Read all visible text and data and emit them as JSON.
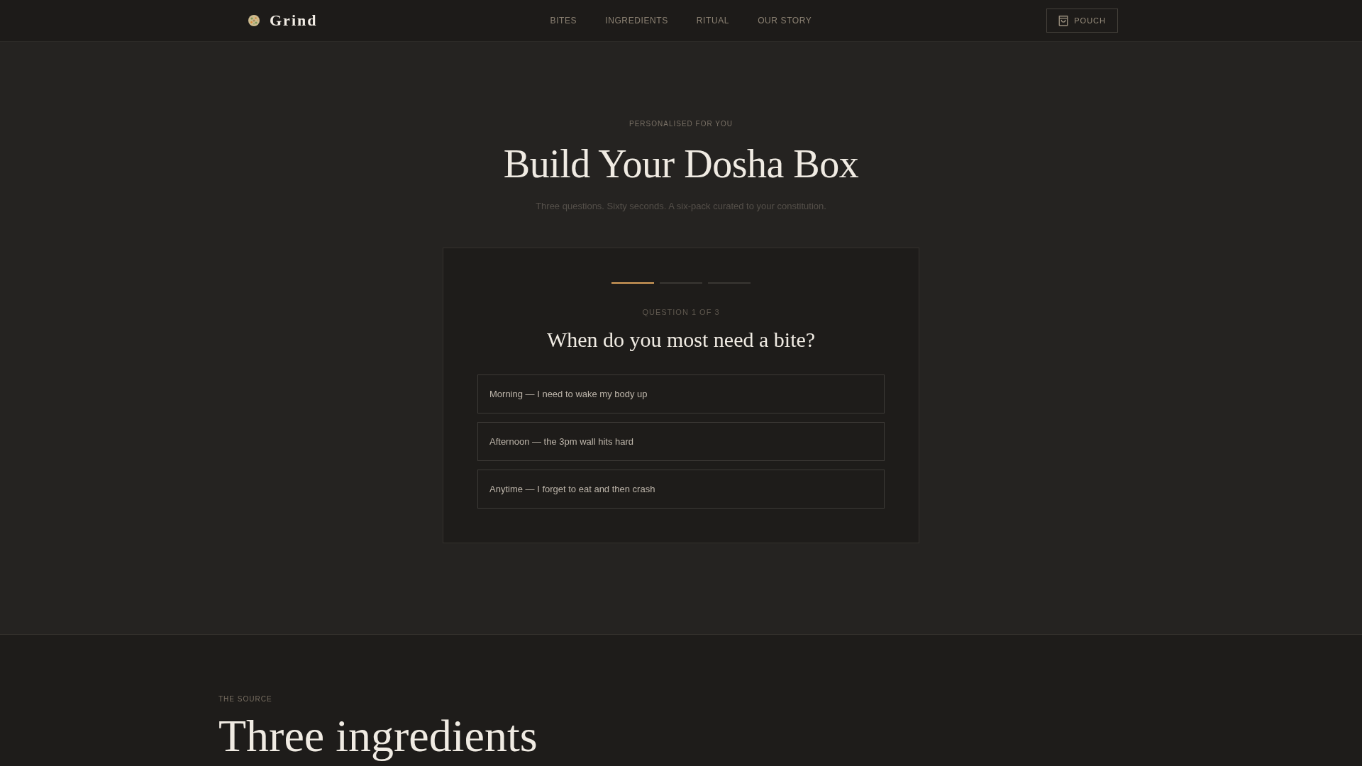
{
  "header": {
    "brand": "Grind",
    "nav": [
      "BITES",
      "INGREDIENTS",
      "RITUAL",
      "OUR STORY"
    ],
    "cart_button": "POUCH"
  },
  "hero": {
    "eyebrow": "PERSONALISED FOR YOU",
    "title": "Build Your Dosha Box",
    "subtitle": "Three questions. Sixty seconds. A six-pack curated to your constitution."
  },
  "quiz": {
    "steps": [
      {
        "active": true
      },
      {
        "active": false
      },
      {
        "active": false
      }
    ],
    "counter": "QUESTION 1 OF 3",
    "question": "When do you most need a bite?",
    "options": [
      {
        "label": "Morning — I need to wake my body up",
        "selected": false
      },
      {
        "label": "Afternoon — the 3pm wall hits hard",
        "selected": false
      },
      {
        "label": "Anytime — I forget to eat and then crash",
        "selected": false
      }
    ]
  },
  "source": {
    "eyebrow": "THE SOURCE",
    "title": "Three ingredients"
  }
}
